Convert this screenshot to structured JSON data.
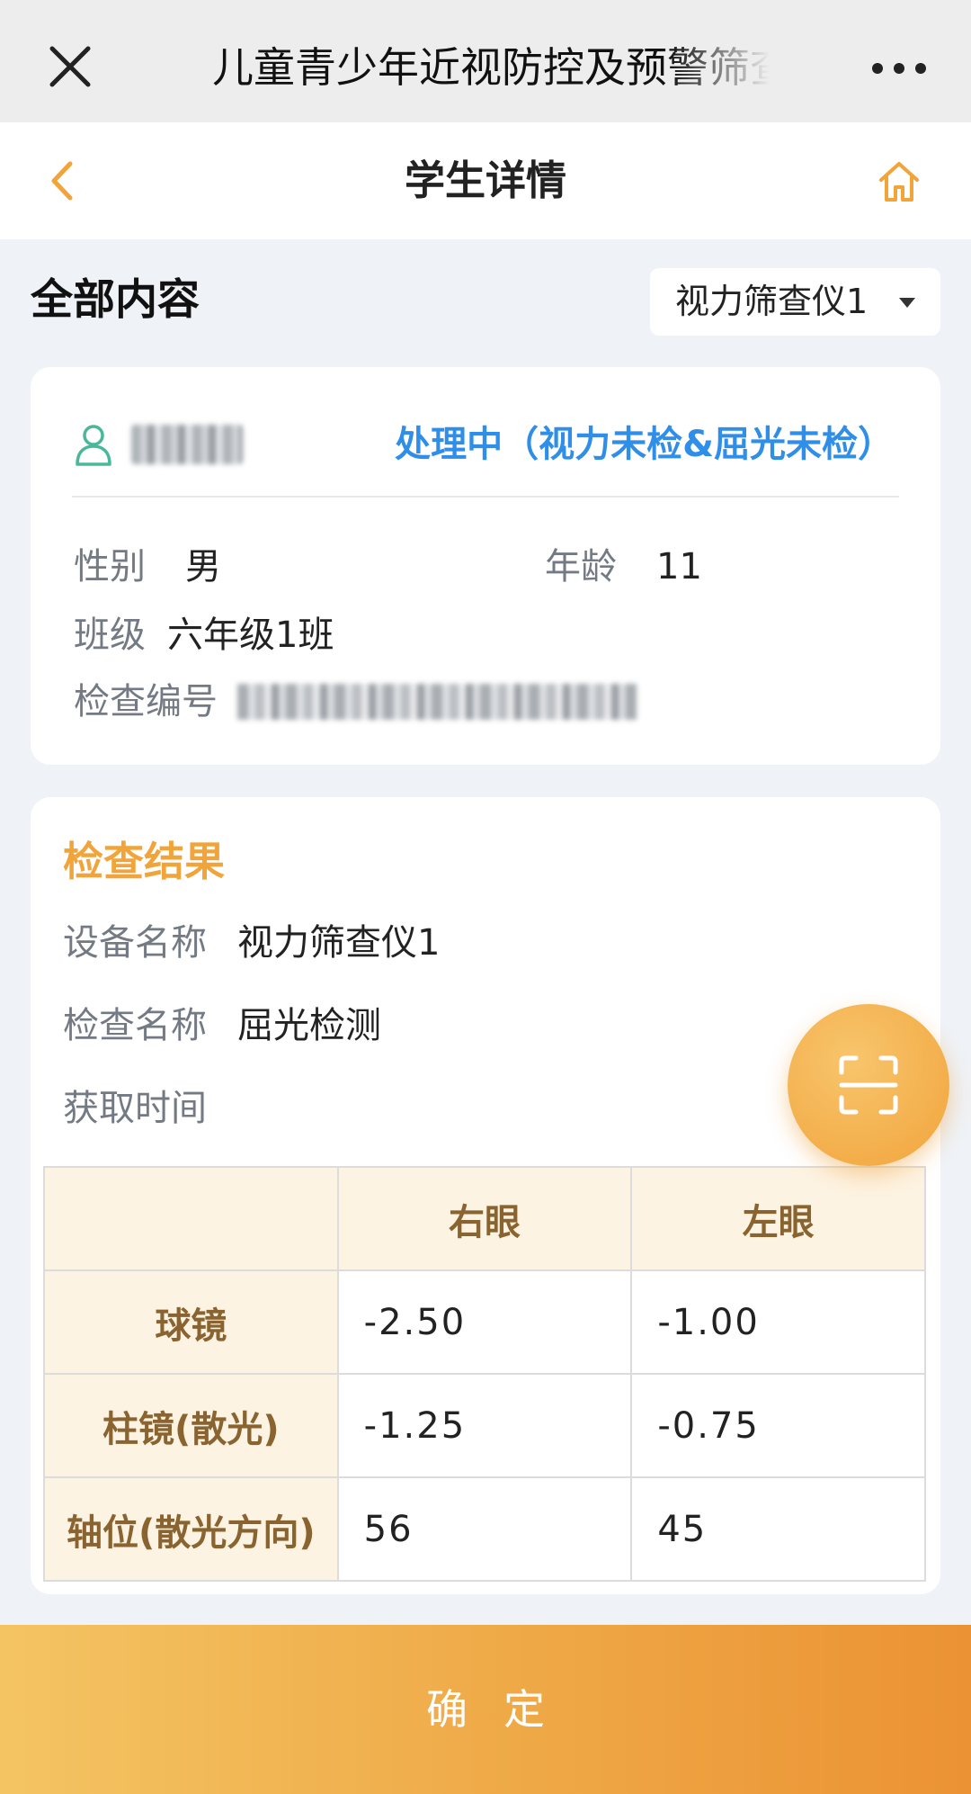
{
  "topbar": {
    "title": "儿童青少年近视防控及预警筛查",
    "close_icon": "close-icon",
    "more_icon": "more-dots-icon"
  },
  "navbar": {
    "title": "学生详情",
    "back_icon": "chevron-left-icon",
    "home_icon": "home-icon"
  },
  "section": {
    "heading": "全部内容",
    "device_select": "视力筛查仪1"
  },
  "student": {
    "status": "处理中（视力未检&屈光未检）",
    "gender_label": "性别",
    "gender": "男",
    "age_label": "年龄",
    "age": "11",
    "class_label": "班级",
    "class": "六年级1班",
    "exam_no_label": "检查编号"
  },
  "result": {
    "title": "检查结果",
    "device_label": "设备名称",
    "device": "视力筛查仪1",
    "exam_label": "检查名称",
    "exam": "屈光检测",
    "time_label": "获取时间",
    "table": {
      "headers": [
        "",
        "右眼",
        "左眼"
      ],
      "rows": [
        {
          "label": "球镜",
          "right": "-2.50",
          "left": "-1.00"
        },
        {
          "label": "柱镜(散光)",
          "right": "-1.25",
          "left": "-0.75"
        },
        {
          "label": "轴位(散光方向)",
          "right": "56",
          "left": "45"
        }
      ]
    }
  },
  "scan_button_icon": "scan-icon",
  "confirm_button": "确定",
  "colors": {
    "accent_orange": "#f0a43a",
    "status_blue": "#2f8ee8",
    "page_bg": "#eff2f6"
  }
}
